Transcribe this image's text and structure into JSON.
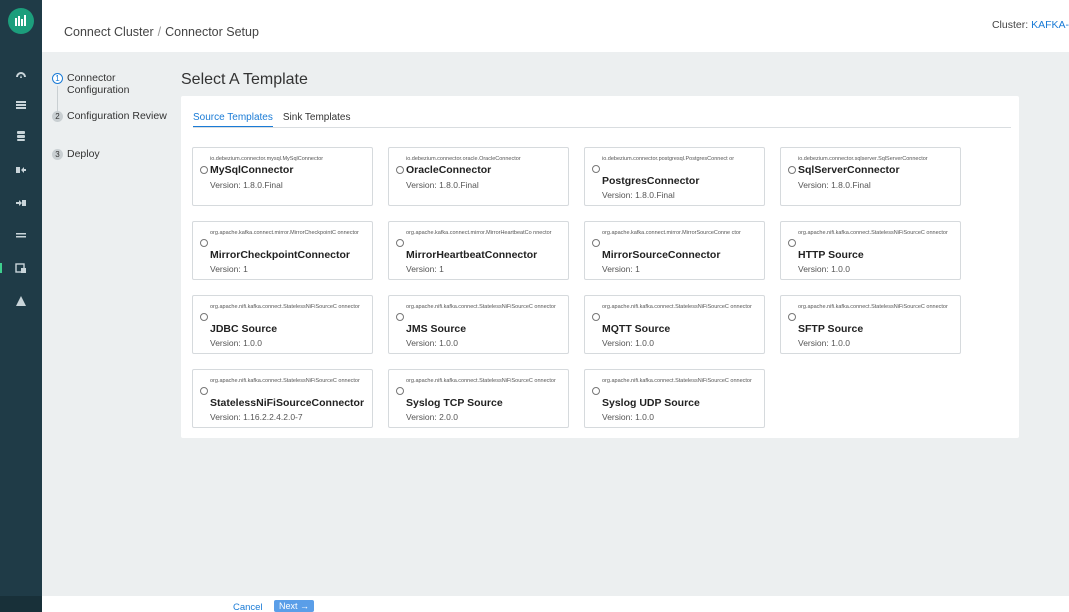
{
  "header": {
    "breadcrumb_root": "Connect Cluster",
    "breadcrumb_sep": "/",
    "breadcrumb_current": "Connector Setup",
    "cluster_label": "Cluster:",
    "cluster_value": "KAFKA-"
  },
  "steps": [
    {
      "num": "1",
      "label": "Connector Configuration",
      "state": "active"
    },
    {
      "num": "2",
      "label": "Configuration Review",
      "state": "pending"
    },
    {
      "num": "3",
      "label": "Deploy",
      "state": "pending"
    }
  ],
  "page_title": "Select A Template",
  "tabs": [
    {
      "label": "Source Templates",
      "selected": true
    },
    {
      "label": "Sink Templates",
      "selected": false
    }
  ],
  "templates": [
    {
      "class_name": "io.debezium.connector.mysql.MySqlConnector",
      "name": "MySqlConnector",
      "version": "Version: 1.8.0.Final"
    },
    {
      "class_name": "io.debezium.connector.oracle.OracleConnector",
      "name": "OracleConnector",
      "version": "Version: 1.8.0.Final"
    },
    {
      "class_name": "io.debezium.connector.postgresql.PostgresConnect or",
      "name": "PostgresConnector",
      "version": "Version: 1.8.0.Final"
    },
    {
      "class_name": "io.debezium.connector.sqlserver.SqlServerConnector",
      "name": "SqlServerConnector",
      "version": "Version: 1.8.0.Final"
    },
    {
      "class_name": "org.apache.kafka.connect.mirror.MirrorCheckpointC onnector",
      "name": "MirrorCheckpointConnector",
      "version": "Version: 1"
    },
    {
      "class_name": "org.apache.kafka.connect.mirror.MirrorHeartbeatCo nnector",
      "name": "MirrorHeartbeatConnector",
      "version": "Version: 1"
    },
    {
      "class_name": "org.apache.kafka.connect.mirror.MirrorSourceConne ctor",
      "name": "MirrorSourceConnector",
      "version": "Version: 1"
    },
    {
      "class_name": "org.apache.nifi.kafka.connect.StatelessNiFiSourceC onnector",
      "name": "HTTP Source",
      "version": "Version: 1.0.0"
    },
    {
      "class_name": "org.apache.nifi.kafka.connect.StatelessNiFiSourceC onnector",
      "name": "JDBC Source",
      "version": "Version: 1.0.0"
    },
    {
      "class_name": "org.apache.nifi.kafka.connect.StatelessNiFiSourceC onnector",
      "name": "JMS Source",
      "version": "Version: 1.0.0"
    },
    {
      "class_name": "org.apache.nifi.kafka.connect.StatelessNiFiSourceC onnector",
      "name": "MQTT Source",
      "version": "Version: 1.0.0"
    },
    {
      "class_name": "org.apache.nifi.kafka.connect.StatelessNiFiSourceC onnector",
      "name": "SFTP Source",
      "version": "Version: 1.0.0"
    },
    {
      "class_name": "org.apache.nifi.kafka.connect.StatelessNiFiSourceC onnector",
      "name": "StatelessNiFiSourceConnector",
      "version": "Version: 1.16.2.2.4.2.0-7"
    },
    {
      "class_name": "org.apache.nifi.kafka.connect.StatelessNiFiSourceC onnector",
      "name": "Syslog TCP Source",
      "version": "Version: 2.0.0"
    },
    {
      "class_name": "org.apache.nifi.kafka.connect.StatelessNiFiSourceC onnector",
      "name": "Syslog UDP Source",
      "version": "Version: 1.0.0"
    }
  ],
  "footer": {
    "cancel_label": "Cancel",
    "next_label": "Next →"
  },
  "colors": {
    "accent": "#1a7bd6",
    "rail": "#1f3b47",
    "logo": "#1c9e7c"
  },
  "rail_icons": [
    "dashboard-icon",
    "list-icon",
    "database-icon",
    "export-icon",
    "import-icon",
    "transfer-icon",
    "connect-icon",
    "alert-icon"
  ]
}
